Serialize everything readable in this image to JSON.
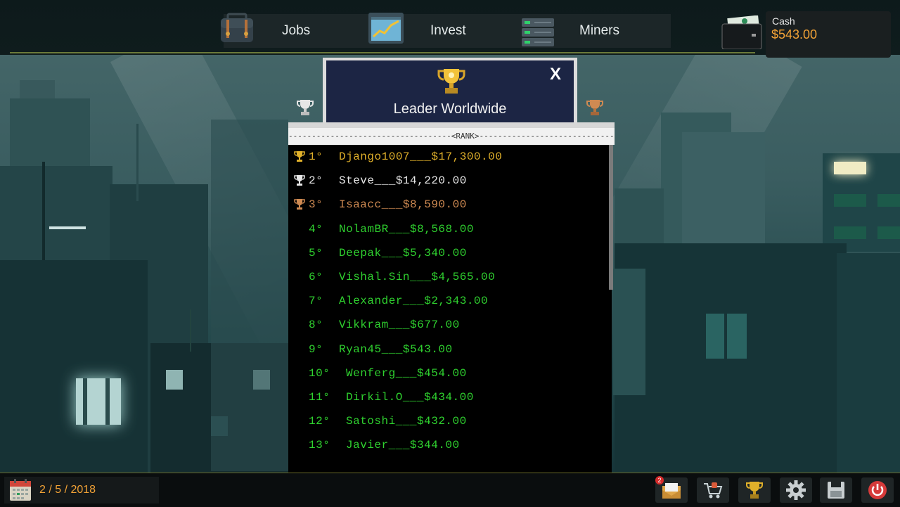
{
  "nav": {
    "jobs_label": "Jobs",
    "invest_label": "Invest",
    "miners_label": "Miners"
  },
  "cash": {
    "label": "Cash",
    "value": "$543.00"
  },
  "modal": {
    "title": "Leader Worldwide",
    "close_label": "X",
    "rank_header": "-----------------------------------<RANK>-----------------------------------"
  },
  "leaderboard": [
    {
      "rank": "1°",
      "entry": "Django1007___$17,300.00",
      "trophy": "gold"
    },
    {
      "rank": "2°",
      "entry": "Steve___$14,220.00",
      "trophy": "silver"
    },
    {
      "rank": "3°",
      "entry": "Isaacc___$8,590.00",
      "trophy": "bronze"
    },
    {
      "rank": "4°",
      "entry": "NolamBR___$8,568.00",
      "trophy": ""
    },
    {
      "rank": "5°",
      "entry": "Deepak___$5,340.00",
      "trophy": ""
    },
    {
      "rank": "6°",
      "entry": "Vishal.Sin___$4,565.00",
      "trophy": ""
    },
    {
      "rank": "7°",
      "entry": "Alexander___$2,343.00",
      "trophy": ""
    },
    {
      "rank": "8°",
      "entry": "Vikkram___$677.00",
      "trophy": ""
    },
    {
      "rank": "9°",
      "entry": "Ryan45___$543.00",
      "trophy": ""
    },
    {
      "rank": "10°",
      "entry": "Wenferg___$454.00",
      "trophy": ""
    },
    {
      "rank": "11°",
      "entry": "Dirkil.O___$434.00",
      "trophy": ""
    },
    {
      "rank": "12°",
      "entry": "Satoshi___$432.00",
      "trophy": ""
    },
    {
      "rank": "13°",
      "entry": "Javier___$344.00",
      "trophy": ""
    }
  ],
  "colors": {
    "gold": "#e0b02a",
    "silver": "#e6e6e6",
    "bronze": "#cf8a52",
    "list_green": "#2fd12f",
    "cash_orange": "#f2a236"
  },
  "bottom": {
    "date": "2 / 5 / 2018",
    "mail_badge": "2"
  },
  "icons": [
    "briefcase-icon",
    "chart-icon",
    "server-rack-icon",
    "wallet-icon",
    "trophy-icon",
    "calendar-icon",
    "mail-icon",
    "shop-cart-icon",
    "gear-icon",
    "save-icon",
    "power-icon"
  ]
}
